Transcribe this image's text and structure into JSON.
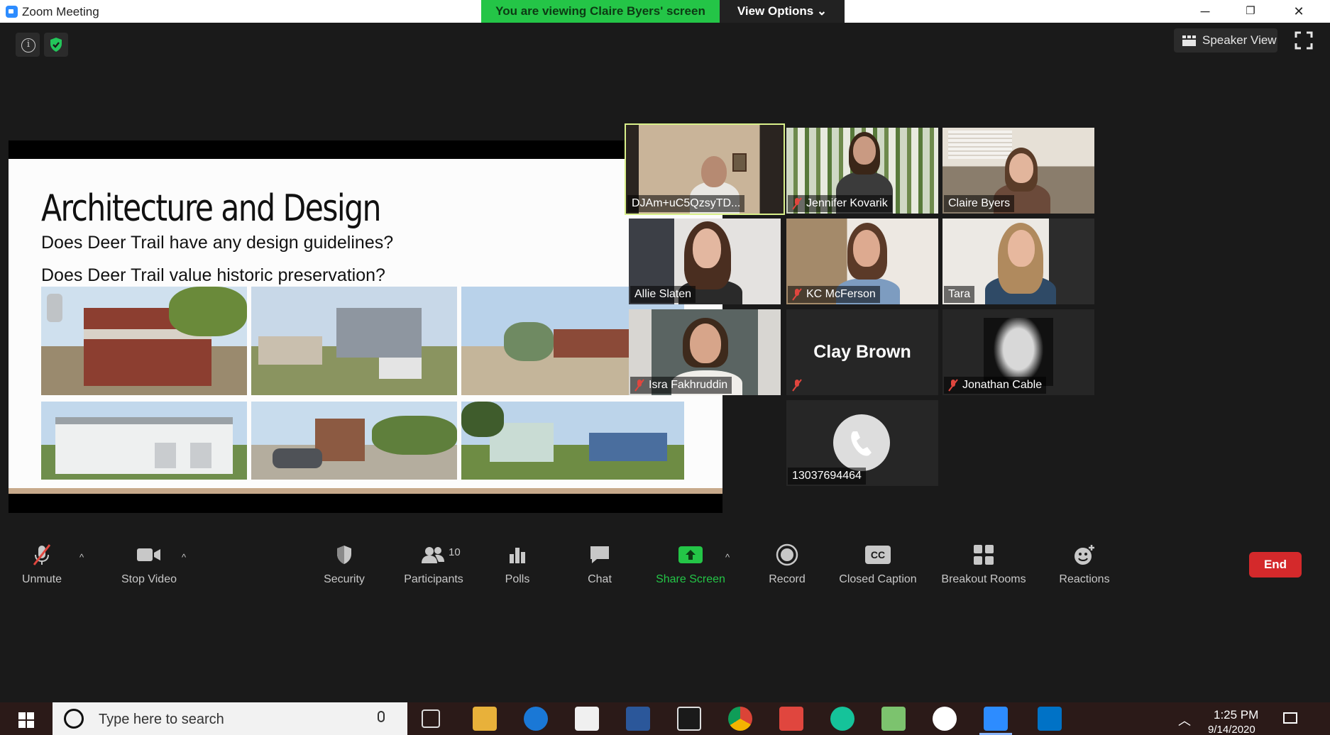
{
  "window": {
    "title": "Zoom Meeting",
    "minimize": "─",
    "restore": "❐",
    "close": "✕"
  },
  "banner": {
    "viewing_text": "You are viewing Claire Byers' screen",
    "view_options": "View Options ⌄"
  },
  "top_right": {
    "speaker_view": "Speaker View"
  },
  "slide": {
    "heading": "Architecture and Design",
    "question_1": "Does Deer Trail have any design guidelines?",
    "question_2": "Does Deer Trail value historic preservation?"
  },
  "participants": [
    {
      "name": "DJAm+uC5QzsyTD...",
      "muted": false,
      "active_speaker": true
    },
    {
      "name": "Jennifer Kovarik",
      "muted": true
    },
    {
      "name": "Claire Byers",
      "muted": false
    },
    {
      "name": "Allie Slaten",
      "muted": false
    },
    {
      "name": "KC McFerson",
      "muted": true
    },
    {
      "name": "Tara",
      "muted": false
    },
    {
      "name": "Isra Fakhruddin",
      "muted": true
    },
    {
      "name": "Clay Brown",
      "muted": true,
      "video_off": true
    },
    {
      "name": "Jonathan Cable",
      "muted": true
    },
    {
      "name": "13037694464",
      "phone": true
    }
  ],
  "toolbar": {
    "unmute": "Unmute",
    "stop_video": "Stop Video",
    "security": "Security",
    "participants": "Participants",
    "participant_count": "10",
    "polls": "Polls",
    "chat": "Chat",
    "share_screen": "Share Screen",
    "record": "Record",
    "closed_caption": "Closed Caption",
    "cc_badge": "CC",
    "breakout_rooms": "Breakout Rooms",
    "reactions": "Reactions",
    "end": "End",
    "caret": "^"
  },
  "taskbar": {
    "search_placeholder": "Type here to search",
    "time": "1:25 PM",
    "date": "9/14/2020",
    "tray_caret": "︿"
  },
  "colors": {
    "banner_green": "#24c547",
    "share_green": "#24c547",
    "end_red": "#d4292b",
    "active_outline": "#d9f08a",
    "mute_red": "#e0463e"
  }
}
